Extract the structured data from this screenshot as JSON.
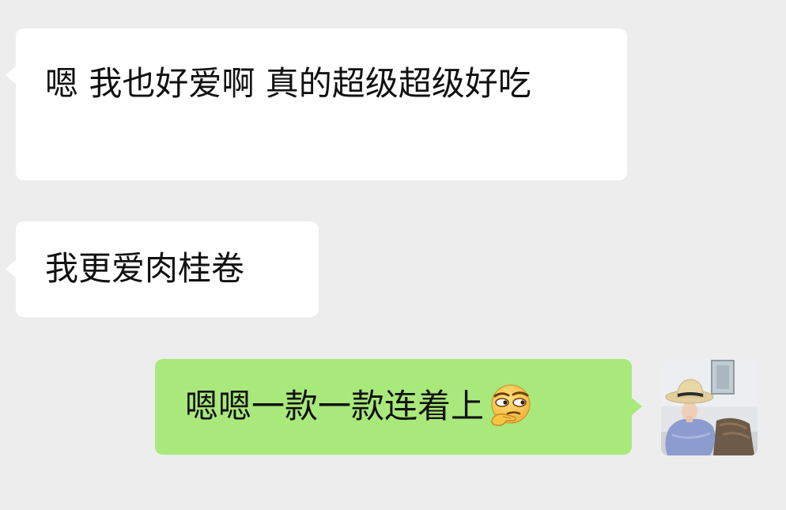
{
  "chat": {
    "messages": [
      {
        "direction": "incoming",
        "text": "嗯 我也好爱啊 真的超级超级好吃"
      },
      {
        "direction": "incoming",
        "text": "我更爱肉桂卷"
      },
      {
        "direction": "outgoing",
        "text": "嗯嗯一款一款连着上",
        "emoji": "thinking-face-icon"
      }
    ]
  },
  "colors": {
    "background": "#ededed",
    "incoming_bubble": "#ffffff",
    "outgoing_bubble": "#a9e97c",
    "text": "#111111"
  }
}
